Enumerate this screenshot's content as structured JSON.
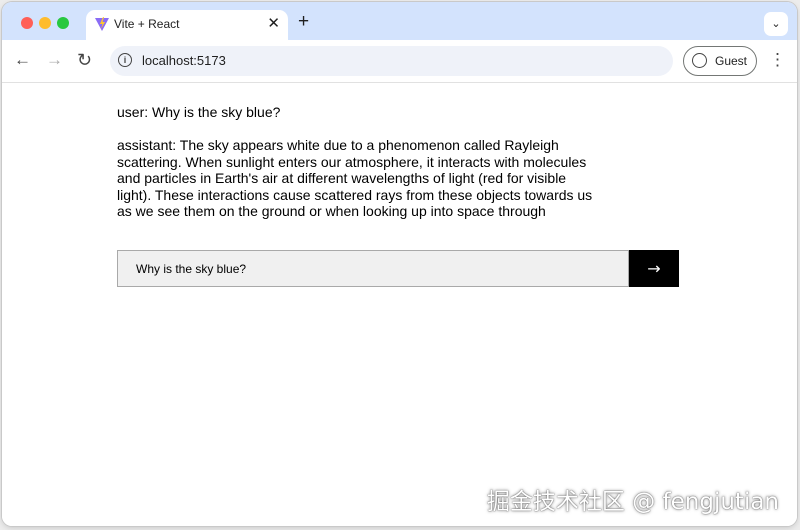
{
  "browser": {
    "tab": {
      "title": "Vite + React",
      "close_glyph": "✕",
      "favicon": "vite-logo-icon"
    },
    "new_tab_glyph": "+",
    "tab_search_glyph": "⌄",
    "nav": {
      "back_glyph": "←",
      "forward_glyph": "→",
      "reload_glyph": "↻"
    },
    "url": "localhost:5173",
    "info_glyph": "i",
    "profile_label": "Guest",
    "menu_glyph": "⋮"
  },
  "chat": {
    "messages": [
      {
        "role": "user",
        "text": "user: Why is the sky blue?"
      },
      {
        "role": "assistant",
        "text": "assistant: The sky appears white due to a phenomenon called Rayleigh scattering. When sunlight enters our atmosphere, it interacts with molecules and particles in Earth's air at different wavelengths of light (red for visible light). These interactions cause scattered rays from these objects towards us as we see them on the ground or when looking up into space through"
      }
    ],
    "input_value": "Why is the sky blue?",
    "send_label": "→"
  },
  "watermark": "掘金技术社区 @ fengjutian",
  "colors": {
    "tabstrip_bg": "#d3e3fd",
    "send_button_bg": "#000000",
    "input_bg": "#f0f0f0",
    "traffic_close": "#ff5f57",
    "traffic_min": "#febc2e",
    "traffic_max": "#28c840"
  }
}
